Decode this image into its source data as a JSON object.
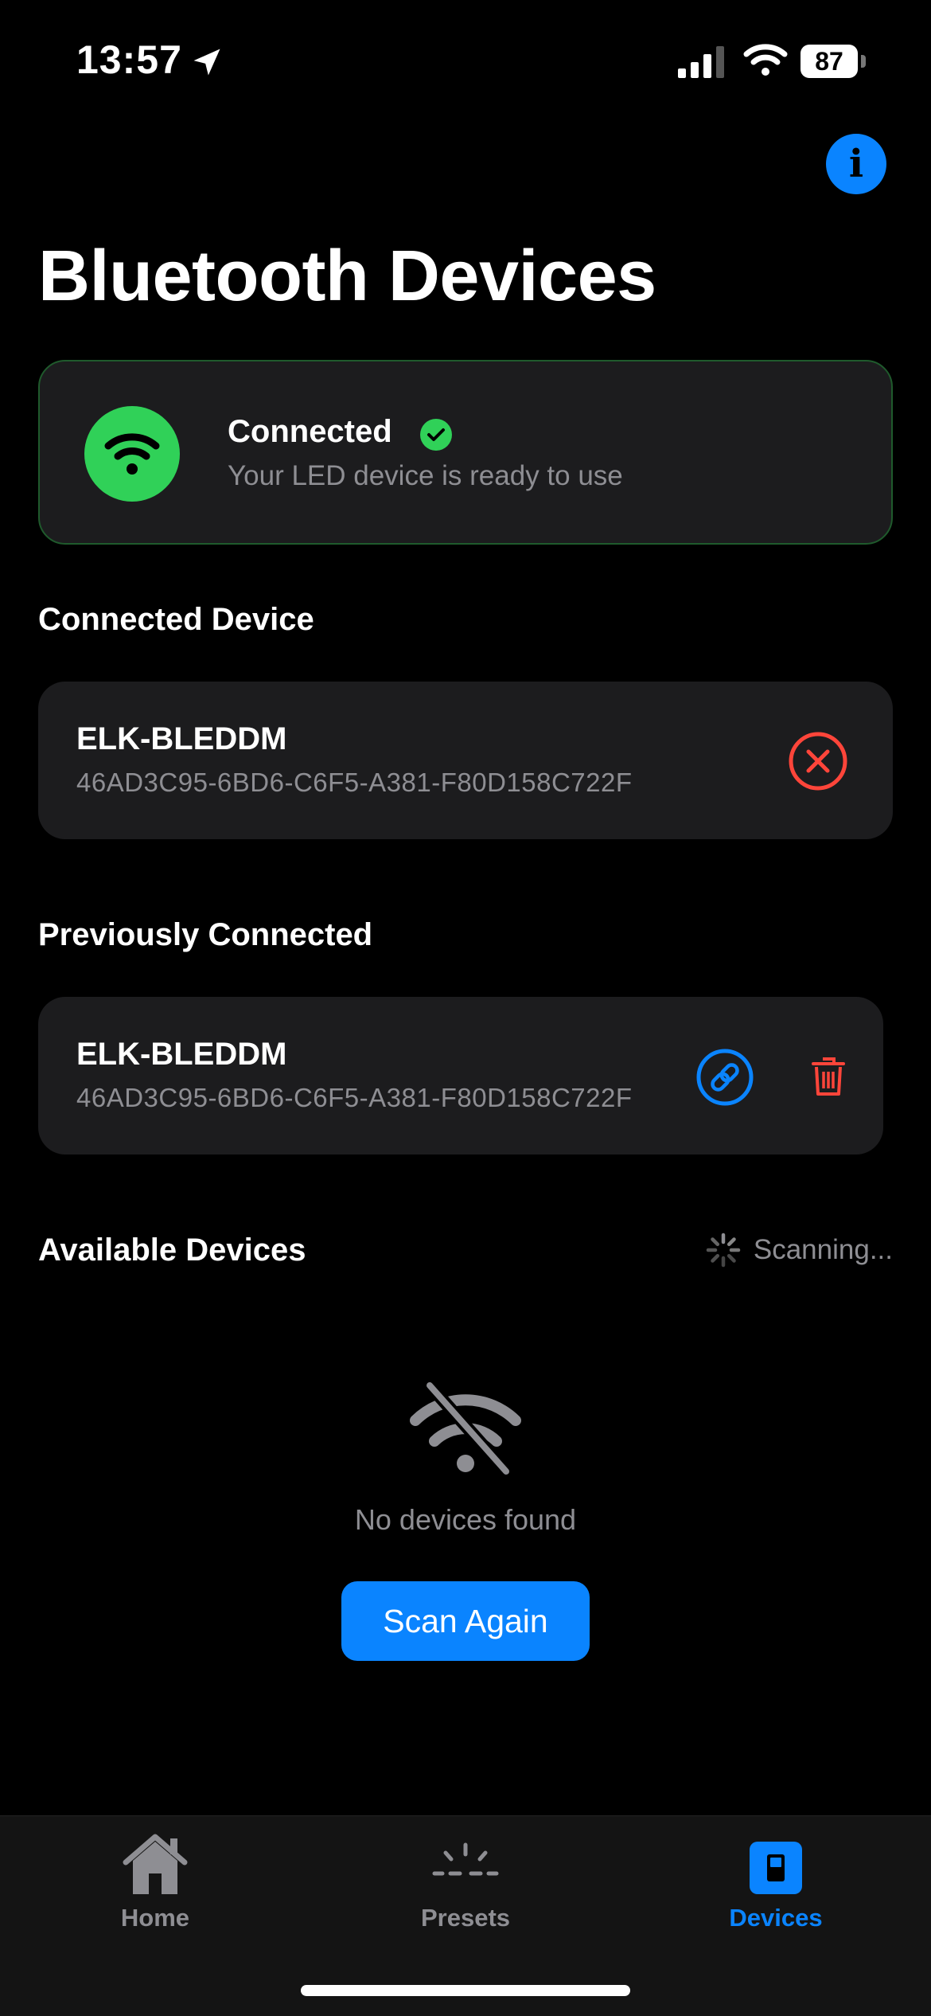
{
  "status_bar": {
    "time": "13:57",
    "battery": "87"
  },
  "header": {
    "title": "Bluetooth Devices",
    "info_icon": "info-icon"
  },
  "connection_status": {
    "title": "Connected",
    "subtitle": "Your LED device is ready to use",
    "accent_color": "#30d158"
  },
  "connected_section": {
    "title": "Connected Device",
    "device": {
      "name": "ELK-BLEDDM",
      "id": "46AD3C95-6BD6-C6F5-A381-F80D158C722F"
    }
  },
  "previous_section": {
    "title": "Previously Connected",
    "devices": [
      {
        "name": "ELK-BLEDDM",
        "id": "46AD3C95-6BD6-C6F5-A381-F80D158C722F"
      }
    ]
  },
  "available_section": {
    "title": "Available Devices",
    "status": "Scanning...",
    "empty_text": "No devices found",
    "scan_button": "Scan Again"
  },
  "tabs": [
    {
      "label": "Home",
      "icon": "house-icon",
      "active": false
    },
    {
      "label": "Presets",
      "icon": "sunrise-icon",
      "active": false
    },
    {
      "label": "Devices",
      "icon": "device-icon",
      "active": true
    }
  ],
  "colors": {
    "accent": "#0a84ff",
    "destructive": "#ff453a",
    "success": "#30d158"
  }
}
